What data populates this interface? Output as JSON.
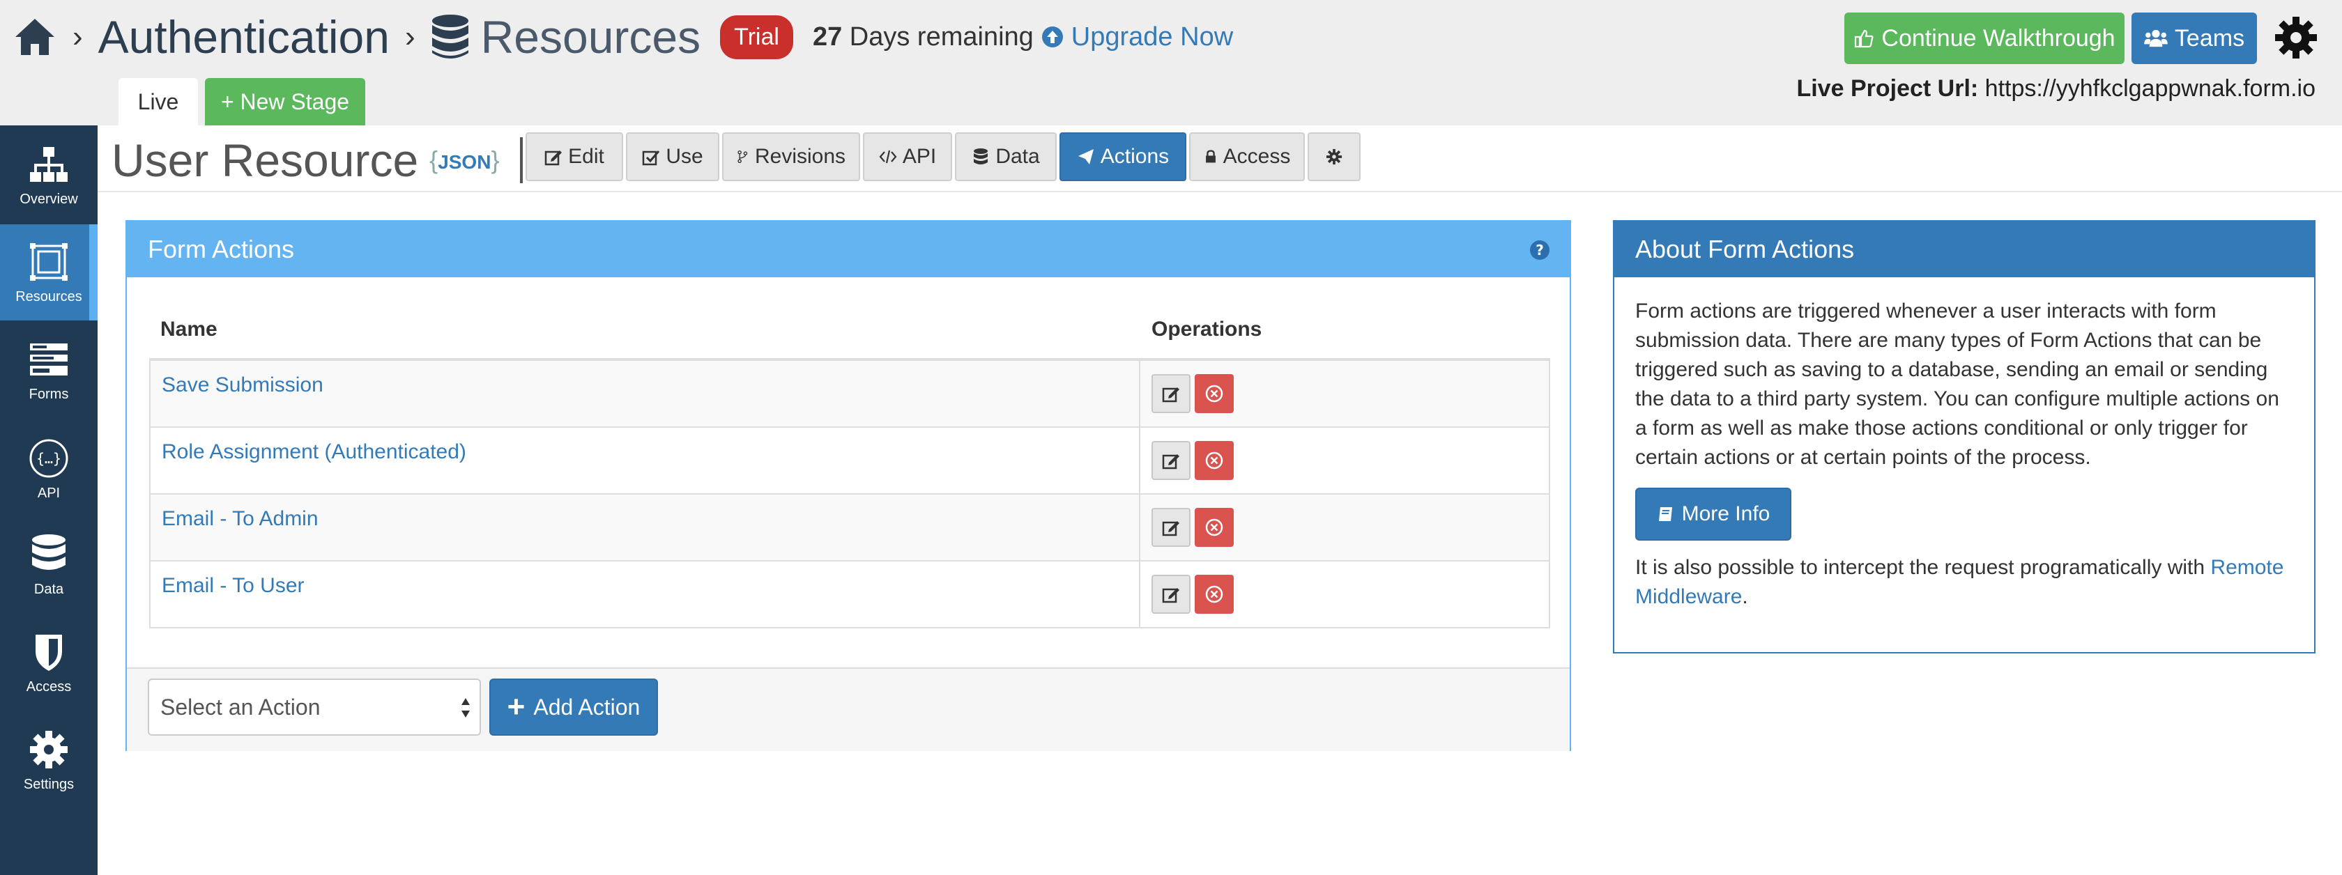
{
  "header": {
    "breadcrumb": [
      "Authentication",
      "Resources"
    ],
    "trial_badge": "Trial",
    "days_count": "27",
    "days_text": "Days remaining",
    "upgrade_label": "Upgrade Now",
    "continue_walkthrough_label": "Continue Walkthrough",
    "teams_label": "Teams",
    "project_url_label": "Live Project Url:",
    "project_url": "https://yyhfkclgappwnak.form.io"
  },
  "stages": {
    "live_label": "Live",
    "new_stage_label": "+ New Stage"
  },
  "sidebar": {
    "items": [
      {
        "label": "Overview",
        "icon": "sitemap-icon"
      },
      {
        "label": "Resources",
        "icon": "resources-icon",
        "active": true
      },
      {
        "label": "Forms",
        "icon": "forms-icon"
      },
      {
        "label": "API",
        "icon": "api-icon"
      },
      {
        "label": "Data",
        "icon": "database-icon"
      },
      {
        "label": "Access",
        "icon": "shield-icon"
      },
      {
        "label": "Settings",
        "icon": "gear-icon"
      }
    ]
  },
  "resource": {
    "title": "User Resource",
    "json_open": "{",
    "json_label": "JSON",
    "json_close": "}"
  },
  "tabs": [
    {
      "label": "Edit"
    },
    {
      "label": "Use"
    },
    {
      "label": "Revisions"
    },
    {
      "label": "API"
    },
    {
      "label": "Data"
    },
    {
      "label": "Actions",
      "active": true
    },
    {
      "label": "Access"
    }
  ],
  "form_actions": {
    "title": "Form Actions",
    "columns": [
      "Name",
      "Operations"
    ],
    "rows": [
      {
        "name": "Save Submission"
      },
      {
        "name": "Role Assignment (Authenticated)"
      },
      {
        "name": "Email - To Admin"
      },
      {
        "name": "Email - To User"
      }
    ],
    "select_placeholder": "Select an Action",
    "add_action_label": "Add Action"
  },
  "about": {
    "title": "About Form Actions",
    "paragraph": "Form actions are triggered whenever a user interacts with form submission data. There are many types of Form Actions that can be triggered such as saving to a database, sending an email or sending the data to a third party system. You can configure multiple actions on a form as well as make those actions conditional or only trigger for certain actions or at certain points of the process.",
    "more_info_label": "More Info",
    "intercept_text": "It is also possible to intercept the request programatically with",
    "middleware_link": "Remote Middleware",
    "period": "."
  },
  "colors": {
    "primary": "#337ab7",
    "success": "#5cb85c",
    "danger": "#d9534f",
    "sidebar": "#1f3a52",
    "panel_header": "#65b4f2"
  }
}
